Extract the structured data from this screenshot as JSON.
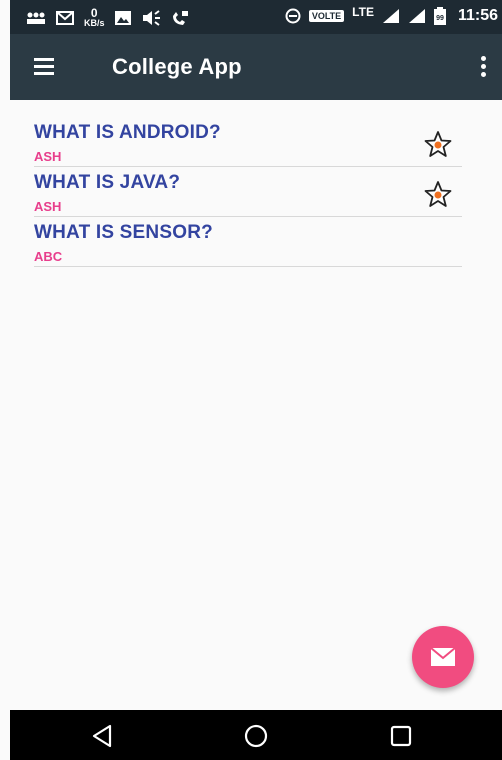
{
  "status_bar": {
    "icons": [
      "people-icon",
      "mail-icon",
      "image-icon",
      "volume-icon",
      "wifi-call-icon",
      "data-saver-icon",
      "signal-icon",
      "signal-icon",
      "battery-icon"
    ],
    "net_speed_value": "0",
    "net_speed_unit": "KB/s",
    "volte_label": "VOLTE",
    "lte_label": "LTE",
    "time": "11:56"
  },
  "app_bar": {
    "title": "College App",
    "background": "#2b3a44"
  },
  "list": {
    "items": [
      {
        "title": "WHAT IS ANDROID?",
        "author": "ASH",
        "starred": true
      },
      {
        "title": "WHAT IS JAVA?",
        "author": "ASH",
        "starred": true
      },
      {
        "title": "WHAT IS SENSOR?",
        "author": "ABC",
        "starred": false
      }
    ]
  },
  "colors": {
    "title_text": "#3344a0",
    "author_text": "#e83e8c",
    "fab": "#f14c80"
  },
  "fab": {
    "icon": "mail-icon"
  },
  "nav_bar": {
    "buttons": [
      "back-icon",
      "home-icon",
      "recents-icon"
    ]
  }
}
